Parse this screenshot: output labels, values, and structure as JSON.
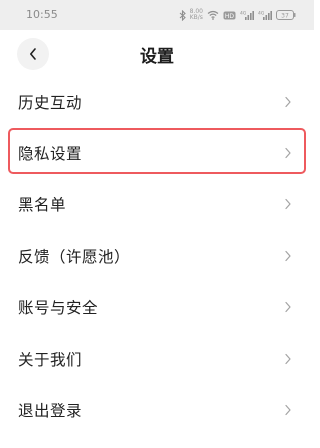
{
  "status_bar": {
    "time": "10:55",
    "net_speed_value": "8.00",
    "net_speed_unit": "KB/s",
    "hd_label": "HD",
    "signal_label": "4G",
    "battery_level": "37"
  },
  "header": {
    "title": "设置"
  },
  "menu": {
    "items": [
      {
        "label": "历史互动"
      },
      {
        "label": "隐私设置",
        "highlighted": true
      },
      {
        "label": "黑名单"
      },
      {
        "label": "反馈（许愿池）"
      },
      {
        "label": "账号与安全"
      },
      {
        "label": "关于我们"
      },
      {
        "label": "退出登录"
      }
    ]
  },
  "icons": {
    "back": "chevron-left-icon",
    "row_arrow": "chevron-right-icon",
    "bluetooth": "bluetooth-icon",
    "wifi": "wifi-icon",
    "signal": "signal-icon",
    "battery": "battery-icon"
  },
  "colors": {
    "highlight_border": "#ee5a5e",
    "status_bar_bg": "#eeeeee",
    "back_button_bg": "#f2f2f2"
  }
}
